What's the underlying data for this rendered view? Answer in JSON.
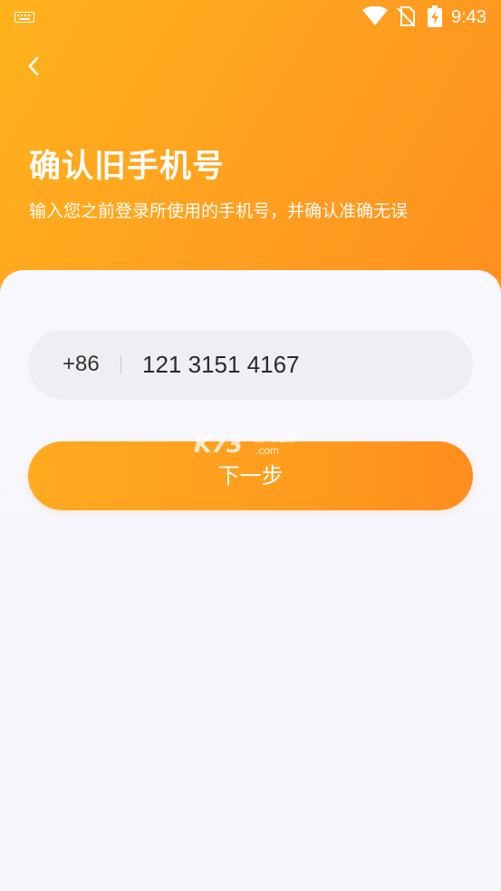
{
  "status_bar": {
    "time": "9:43",
    "icons": [
      "keyboard-icon",
      "wifi-icon",
      "no-sim-icon",
      "battery-charging-icon"
    ]
  },
  "header": {
    "back_icon": "chevron-left-icon",
    "title": "确认旧手机号",
    "subtitle": "输入您之前登录所使用的手机号，并确认准确无误"
  },
  "form": {
    "country_code": "+86",
    "phone_value": "121 3151 4167",
    "next_label": "下一步"
  },
  "watermark": {
    "logo": "K73",
    "name": "游戏之家",
    "domain": ".com"
  },
  "colors": {
    "accent_start": "#FFB21C",
    "accent_end": "#FF8F1E",
    "card_bg": "#F7F7FD",
    "field_bg": "#EEEFF3"
  }
}
